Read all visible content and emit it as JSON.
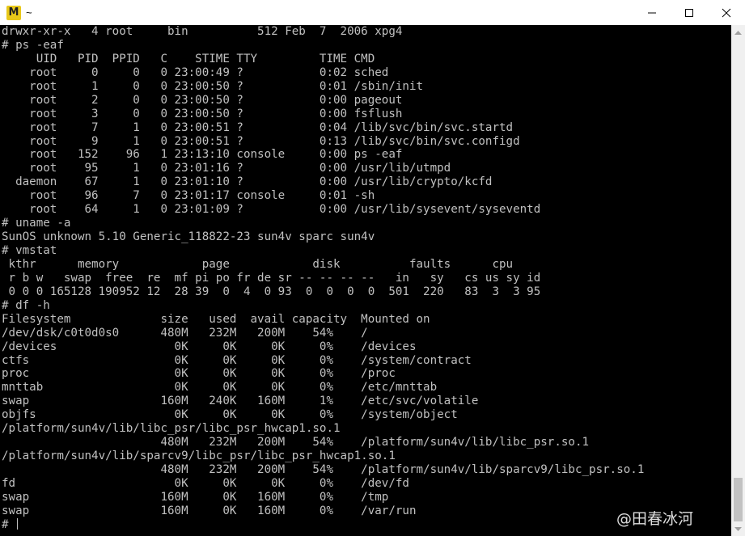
{
  "window": {
    "app_icon_glyph": "M",
    "title": "~",
    "controls": {
      "minimize": "─",
      "maximize": "☐",
      "close": "✕"
    }
  },
  "terminal": {
    "lines": [
      "drwxr-xr-x   4 root     bin          512 Feb  7  2006 xpg4",
      "# ps -eaf",
      "     UID   PID  PPID   C    STIME TTY         TIME CMD",
      "    root     0     0   0 23:00:49 ?           0:02 sched",
      "    root     1     0   0 23:00:50 ?           0:01 /sbin/init",
      "    root     2     0   0 23:00:50 ?           0:00 pageout",
      "    root     3     0   0 23:00:50 ?           0:00 fsflush",
      "    root     7     1   0 23:00:51 ?           0:04 /lib/svc/bin/svc.startd",
      "    root     9     1   0 23:00:51 ?           0:13 /lib/svc/bin/svc.configd",
      "    root   152    96   1 23:13:10 console     0:00 ps -eaf",
      "    root    95     1   0 23:01:16 ?           0:00 /usr/lib/utmpd",
      "  daemon    67     1   0 23:01:10 ?           0:00 /usr/lib/crypto/kcfd",
      "    root    96     7   0 23:01:17 console     0:01 -sh",
      "    root    64     1   0 23:01:09 ?           0:00 /usr/lib/sysevent/syseventd",
      "# uname -a",
      "SunOS unknown 5.10 Generic_118822-23 sun4v sparc sun4v",
      "# vmstat",
      " kthr      memory            page            disk          faults      cpu",
      " r b w   swap  free  re  mf pi po fr de sr -- -- -- --   in   sy   cs us sy id",
      " 0 0 0 165128 190952 12  28 39  0  4  0 93  0  0  0  0  501  220   83  3  3 95",
      "# df -h",
      "Filesystem             size   used  avail capacity  Mounted on",
      "/dev/dsk/c0t0d0s0      480M   232M   200M    54%    /",
      "/devices                 0K     0K     0K     0%    /devices",
      "ctfs                     0K     0K     0K     0%    /system/contract",
      "proc                     0K     0K     0K     0%    /proc",
      "mnttab                   0K     0K     0K     0%    /etc/mnttab",
      "swap                   160M   240K   160M     1%    /etc/svc/volatile",
      "objfs                    0K     0K     0K     0%    /system/object",
      "/platform/sun4v/lib/libc_psr/libc_psr_hwcap1.so.1",
      "                       480M   232M   200M    54%    /platform/sun4v/lib/libc_psr.so.1",
      "/platform/sun4v/lib/sparcv9/libc_psr/libc_psr_hwcap1.so.1",
      "                       480M   232M   200M    54%    /platform/sun4v/lib/sparcv9/libc_psr.so.1",
      "fd                       0K     0K     0K     0%    /dev/fd",
      "swap                   160M     0K   160M     0%    /tmp",
      "swap                   160M     0K   160M     0%    /var/run"
    ],
    "prompt": "# "
  },
  "watermark": {
    "text": "@田春冰河"
  },
  "colors": {
    "terminal_bg": "#000000",
    "terminal_fg": "#c0c0c0",
    "app_icon": "#e8c81a"
  }
}
